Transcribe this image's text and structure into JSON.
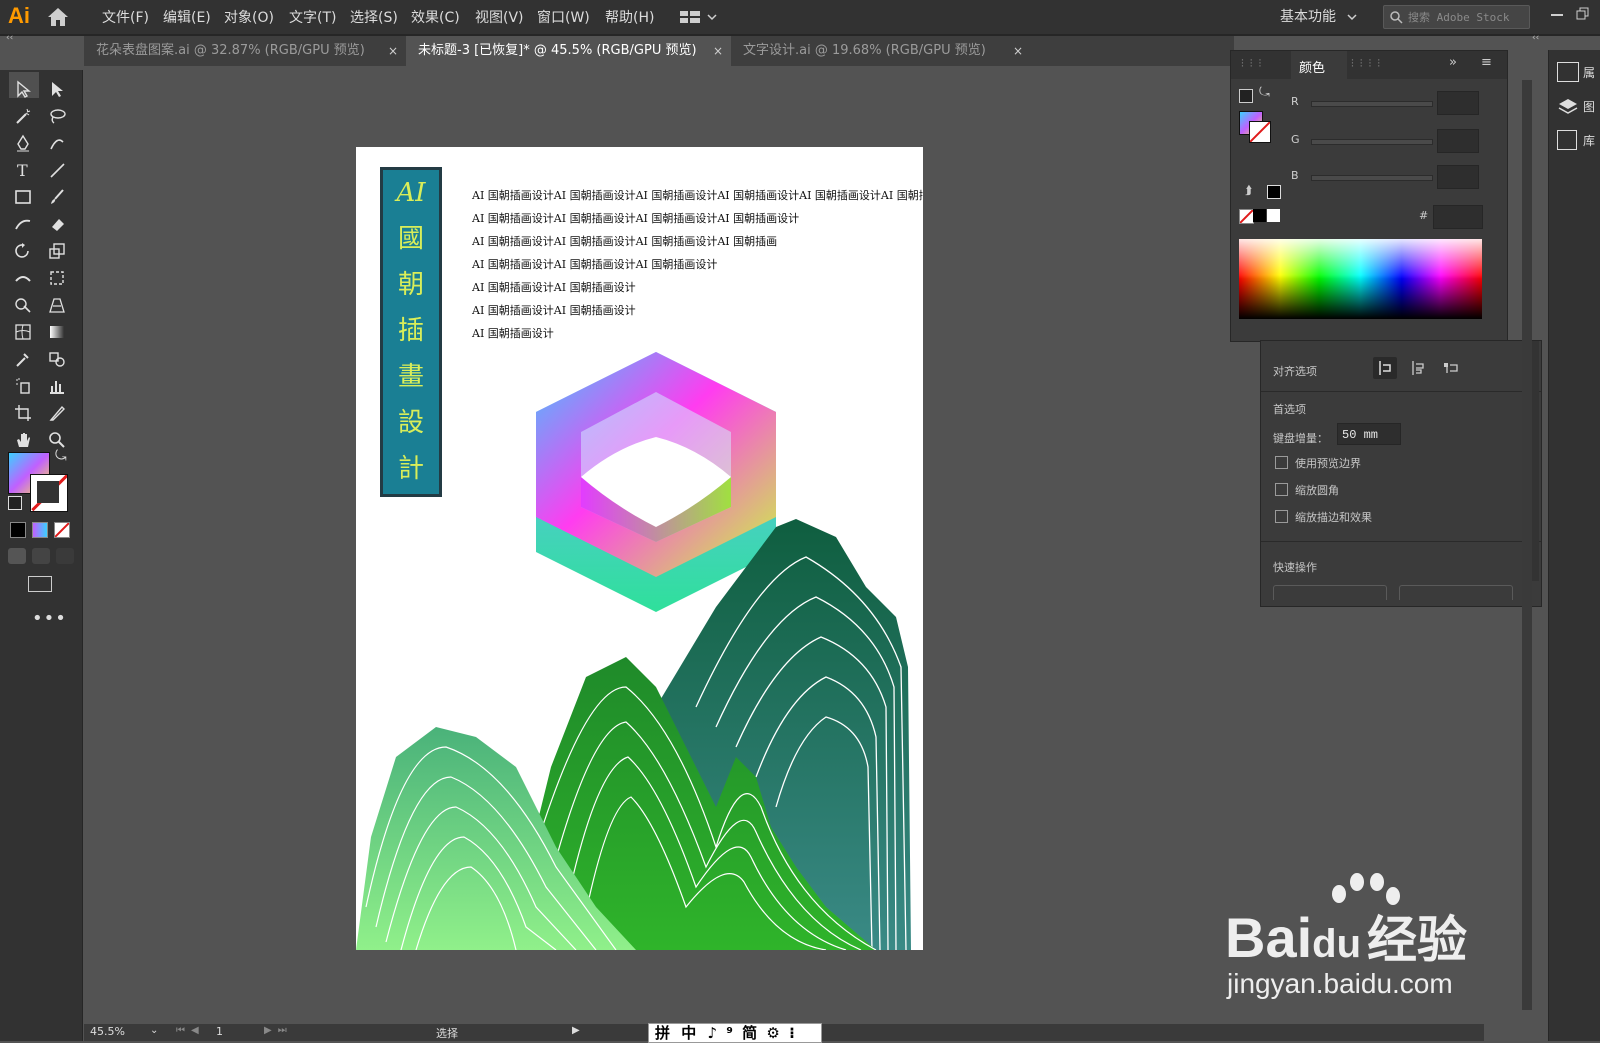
{
  "app": {
    "logo": "Ai",
    "menu": [
      "文件(F)",
      "编辑(E)",
      "对象(O)",
      "文字(T)",
      "选择(S)",
      "效果(C)",
      "视图(V)",
      "窗口(W)",
      "帮助(H)"
    ],
    "workspace": "基本功能",
    "search_placeholder": "搜索 Adobe Stock"
  },
  "tabs": [
    {
      "label": "花朵表盘图案.ai @ 32.87% (RGB/GPU 预览)",
      "close": "×"
    },
    {
      "label": "未标题-3 [已恢复]* @ 45.5% (RGB/GPU 预览)",
      "close": "×"
    },
    {
      "label": "文字设计.ai @ 19.68% (RGB/GPU 预览)",
      "close": "×"
    }
  ],
  "artboard": {
    "title_chars": [
      "AI",
      "國",
      "朝",
      "插",
      "畫",
      "設",
      "計"
    ],
    "text_lines": [
      "AI 国朝插画设计AI 国朝插画设计AI 国朝插画设计AI 国朝插画设计AI 国朝插画设计AI 国朝插画",
      "AI 国朝插画设计AI 国朝插画设计AI 国朝插画设计AI 国朝插画设计",
      "AI 国朝插画设计AI 国朝插画设计AI 国朝插画设计AI 国朝插画",
      "AI 国朝插画设计AI 国朝插画设计AI 国朝插画设计",
      "AI 国朝插画设计AI 国朝插画设计",
      "AI 国朝插画设计AI 国朝插画设计",
      "AI 国朝插画设计"
    ]
  },
  "color_panel": {
    "title": "颜色",
    "channels": [
      "R",
      "G",
      "B"
    ],
    "hex_label": "#"
  },
  "properties_panel": {
    "align_options": "对齐选项",
    "preferences": "首选项",
    "keyboard_increment_label": "键盘增量：",
    "keyboard_increment_value": "50 mm",
    "checkboxes": [
      "使用预览边界",
      "缩放圆角",
      "缩放描边和效果"
    ],
    "quick_actions": "快速操作"
  },
  "right_dock": [
    "属",
    "图",
    "库"
  ],
  "status": {
    "zoom": "45.5%",
    "page": "1",
    "tool": "选择"
  },
  "ime": [
    "拼",
    "中",
    "♪",
    "⁹",
    "简",
    "⚙",
    "⁝"
  ],
  "watermark": {
    "brand": "Bai",
    "brand2": "du",
    "cn": "经验",
    "url": "jingyan.baidu.com"
  },
  "colors": {
    "title_bg": "#1a7f94",
    "title_text": "#d9ee59",
    "accent": "#ff9a00"
  }
}
